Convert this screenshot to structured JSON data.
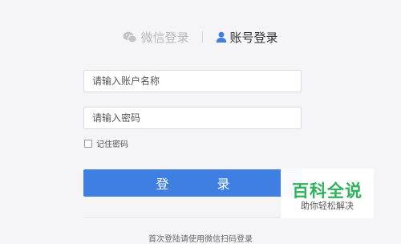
{
  "tabs": {
    "wechat_login": "微信登录",
    "account_login": "账号登录"
  },
  "form": {
    "account_placeholder": "请输入账户名称",
    "password_placeholder": "请输入密码",
    "remember_label": "记住密码",
    "login_button": "登　录"
  },
  "footer": {
    "note": "首次登陆请使用微信扫码登录"
  },
  "watermark": {
    "title": "百科全说",
    "subtitle": "助你轻松解决"
  },
  "colors": {
    "primary": "#3f7fe2",
    "watermark_green": "#2fb25a"
  }
}
